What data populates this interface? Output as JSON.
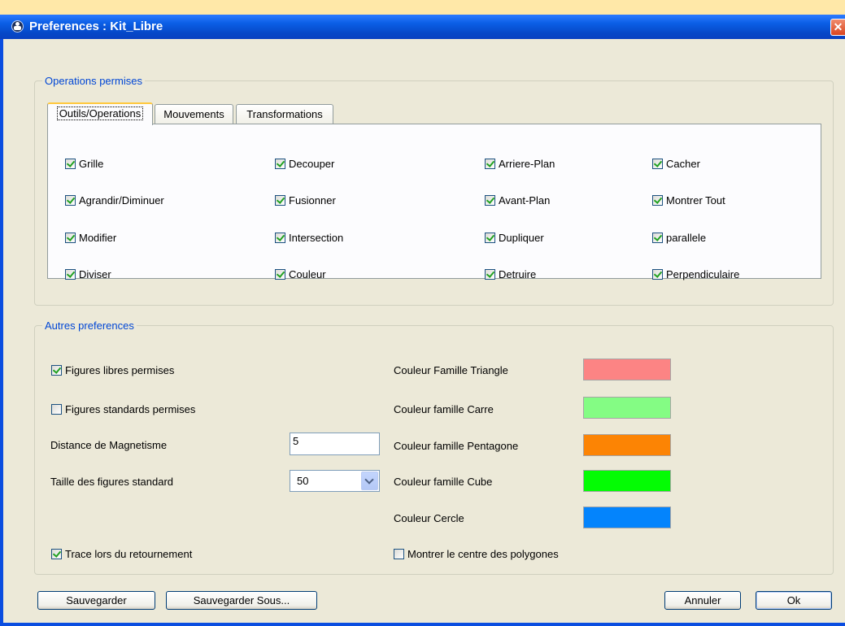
{
  "window": {
    "title": "Preferences : Kit_Libre",
    "close_glyph": "✕",
    "icon": "app-icon"
  },
  "operations": {
    "legend": "Operations permises",
    "tabs": [
      {
        "label": "Outils/Operations",
        "active": true
      },
      {
        "label": "Mouvements",
        "active": false
      },
      {
        "label": "Transformations",
        "active": false
      }
    ],
    "checkboxes": [
      {
        "label": "Grille",
        "checked": true
      },
      {
        "label": "Decouper",
        "checked": true
      },
      {
        "label": "Arriere-Plan",
        "checked": true
      },
      {
        "label": "Cacher",
        "checked": true
      },
      {
        "label": "Agrandir/Diminuer",
        "checked": true
      },
      {
        "label": "Fusionner",
        "checked": true
      },
      {
        "label": "Avant-Plan",
        "checked": true
      },
      {
        "label": "Montrer Tout",
        "checked": true
      },
      {
        "label": "Modifier",
        "checked": true
      },
      {
        "label": "Intersection",
        "checked": true
      },
      {
        "label": "Dupliquer",
        "checked": true
      },
      {
        "label": "parallele",
        "checked": true
      },
      {
        "label": "Diviser",
        "checked": true
      },
      {
        "label": "Couleur",
        "checked": true
      },
      {
        "label": "Detruire",
        "checked": true
      },
      {
        "label": "Perpendiculaire",
        "checked": true
      }
    ]
  },
  "autres": {
    "legend": "Autres preferences",
    "figures_libres": {
      "label": "Figures libres permises",
      "checked": true
    },
    "figures_standards": {
      "label": "Figures standards permises",
      "checked": false
    },
    "distance": {
      "label": "Distance de Magnetisme",
      "value": "5"
    },
    "taille": {
      "label": "Taille des figures standard",
      "value": "50"
    },
    "trace": {
      "label": "Trace lors du retournement",
      "checked": true
    },
    "montrer_centre": {
      "label": "Montrer le centre des polygones",
      "checked": false
    },
    "colors": [
      {
        "label": "Couleur Famille Triangle",
        "color": "#fc8484"
      },
      {
        "label": "Couleur famille Carre",
        "color": "#84fc84"
      },
      {
        "label": "Couleur famille Pentagone",
        "color": "#fc8404"
      },
      {
        "label": "Couleur famille Cube",
        "color": "#04fc04"
      },
      {
        "label": "Couleur Cercle",
        "color": "#0484fc"
      }
    ]
  },
  "buttons": {
    "save": "Sauvegarder",
    "save_as": "Sauvegarder Sous...",
    "cancel": "Annuler",
    "ok": "Ok"
  }
}
